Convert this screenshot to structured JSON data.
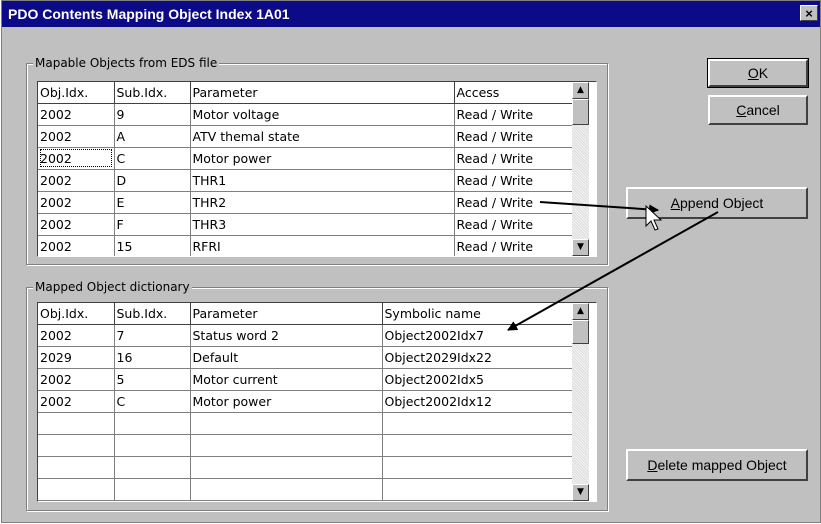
{
  "window": {
    "title": "PDO Contents Mapping Object Index 1A01",
    "close_label": "×"
  },
  "eds_group": {
    "legend": "Mapable Objects from EDS file",
    "columns": [
      "Obj.Idx.",
      "Sub.Idx.",
      "Parameter",
      "Access"
    ],
    "rows": [
      [
        "2002",
        "9",
        "Motor voltage",
        "Read / Write"
      ],
      [
        "2002",
        "A",
        "ATV themal state",
        "Read / Write"
      ],
      [
        "2002",
        "C",
        "Motor power",
        "Read / Write"
      ],
      [
        "2002",
        "D",
        "THR1",
        "Read / Write"
      ],
      [
        "2002",
        "E",
        "THR2",
        "Read / Write"
      ],
      [
        "2002",
        "F",
        "THR3",
        "Read / Write"
      ],
      [
        "2002",
        "15",
        "RFRI",
        "Read / Write"
      ]
    ]
  },
  "mapped_group": {
    "legend": "Mapped Object dictionary",
    "columns": [
      "Obj.Idx.",
      "Sub.Idx.",
      "Parameter",
      "Symbolic name"
    ],
    "rows": [
      [
        "2002",
        "7",
        "Status word 2",
        "Object2002Idx7"
      ],
      [
        "2029",
        "16",
        "Default",
        "Object2029Idx22"
      ],
      [
        "2002",
        "5",
        "Motor current",
        "Object2002Idx5"
      ],
      [
        "2002",
        "C",
        "Motor power",
        "Object2002Idx12"
      ],
      [
        "",
        "",
        "",
        ""
      ],
      [
        "",
        "",
        "",
        ""
      ],
      [
        "",
        "",
        "",
        ""
      ],
      [
        "",
        "",
        "",
        ""
      ]
    ]
  },
  "buttons": {
    "ok": {
      "mnemonic": "O",
      "rest": "K"
    },
    "cancel": {
      "mnemonic": "C",
      "rest": "ancel"
    },
    "append": {
      "mnemonic": "A",
      "rest": "ppend Object"
    },
    "delete": {
      "mnemonic": "D",
      "rest": "elete mapped Object"
    }
  },
  "icons": {
    "scroll_up": "scroll-up-arrow-icon",
    "scroll_down": "scroll-down-arrow-icon",
    "cursor": "mouse-pointer-icon"
  },
  "colors": {
    "title_bar": "#0c0a86",
    "face": "#c0c0c0"
  }
}
